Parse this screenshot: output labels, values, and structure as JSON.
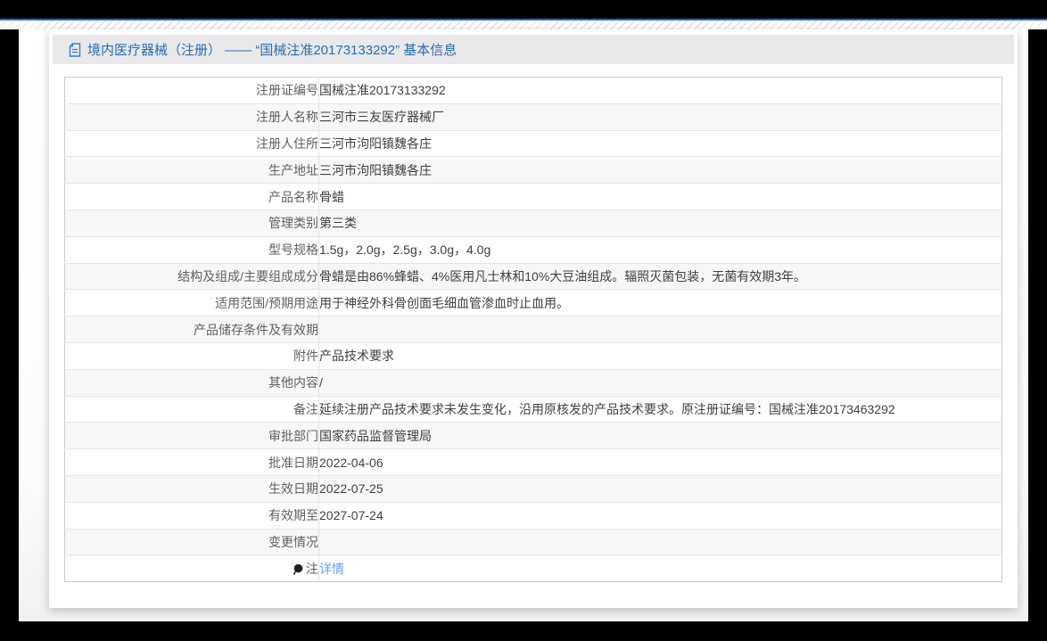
{
  "window": {
    "frame_color": "#000000",
    "accent_color": "#1774cf"
  },
  "header": {
    "icon": "document-icon",
    "title": "境内医疗器械（注册） —— “国械注准20173133292” 基本信息",
    "title_color": "#2b6cb0"
  },
  "table": {
    "link_color": "#5ba0f0",
    "rows": [
      {
        "label": "注册证编号",
        "value": "国械注准20173133292"
      },
      {
        "label": "注册人名称",
        "value": "三河市三友医疗器械厂"
      },
      {
        "label": "注册人住所",
        "value": "三河市泃阳镇魏各庄"
      },
      {
        "label": "生产地址",
        "value": "三河市泃阳镇魏各庄"
      },
      {
        "label": "产品名称",
        "value": "骨蜡"
      },
      {
        "label": "管理类别",
        "value": "第三类"
      },
      {
        "label": "型号规格",
        "value": "1.5g，2.0g，2.5g，3.0g，4.0g"
      },
      {
        "label": "结构及组成/主要组成成分",
        "value": "骨蜡是由86%蜂蜡、4%医用凡士林和10%大豆油组成。辐照灭菌包装，无菌有效期3年。"
      },
      {
        "label": "适用范围/预期用途",
        "value": "用于神经外科骨创面毛细血管渗血时止血用。"
      },
      {
        "label": "产品储存条件及有效期",
        "value": ""
      },
      {
        "label": "附件",
        "value": "产品技术要求"
      },
      {
        "label": "其他内容",
        "value": "/"
      },
      {
        "label": "备注",
        "value": "延续注册产品技术要求未发生变化，沿用原核发的产品技术要求。原注册证编号：国械注准20173463292"
      },
      {
        "label": "审批部门",
        "value": "国家药品监督管理局"
      },
      {
        "label": "批准日期",
        "value": "2022-04-06"
      },
      {
        "label": "生效日期",
        "value": "2022-07-25"
      },
      {
        "label": "有效期至",
        "value": "2027-07-24"
      },
      {
        "label": "变更情况",
        "value": ""
      },
      {
        "label": "注",
        "icon": "note-icon",
        "value": "详情",
        "link": true
      }
    ]
  }
}
